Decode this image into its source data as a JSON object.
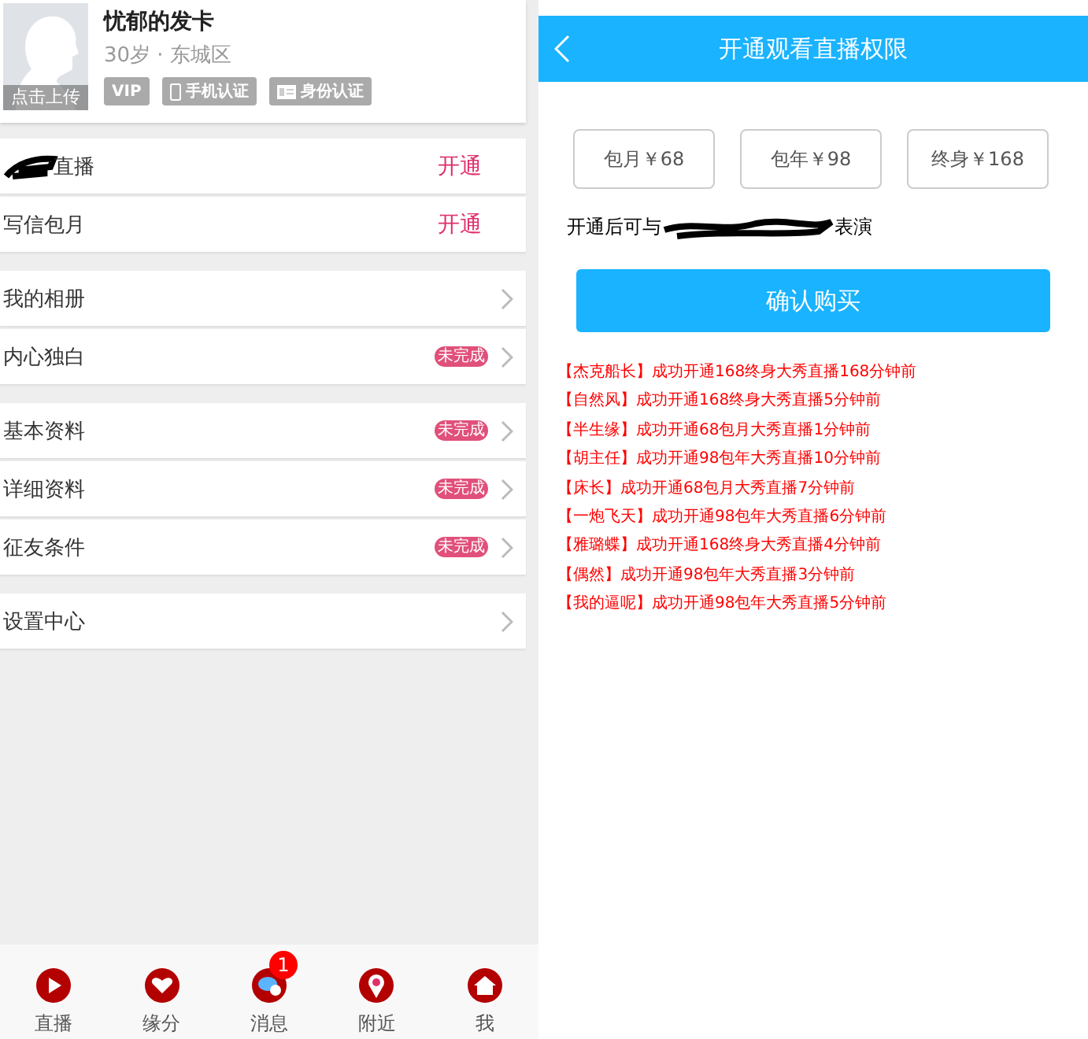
{
  "profile": {
    "name": "忧郁的发卡",
    "info": "30岁 · 东城区",
    "upload_label": "点击上传",
    "badges": [
      {
        "kind": "vip",
        "label": "VIP"
      },
      {
        "kind": "phone",
        "label": "手机认证"
      },
      {
        "kind": "id",
        "label": "身份认证"
      }
    ]
  },
  "menu_groups": [
    {
      "items": [
        {
          "label": "直播",
          "redacted": true,
          "action": "开通"
        },
        {
          "label": "写信包月",
          "redacted": false,
          "action": "开通"
        }
      ]
    },
    {
      "items": [
        {
          "label": "我的相册",
          "redacted": false
        },
        {
          "label": "内心独白",
          "redacted": false,
          "status": "未完成"
        }
      ]
    },
    {
      "items": [
        {
          "label": "基本资料",
          "redacted": false,
          "status": "未完成"
        },
        {
          "label": "详细资料",
          "redacted": false,
          "status": "未完成"
        },
        {
          "label": "征友条件",
          "redacted": false,
          "status": "未完成"
        }
      ]
    },
    {
      "items": [
        {
          "label": "设置中心",
          "redacted": false
        }
      ]
    }
  ],
  "tab_bar": [
    {
      "kind": "play",
      "label": "直播"
    },
    {
      "kind": "heart",
      "label": "缘分"
    },
    {
      "kind": "chat",
      "label": "消息",
      "badge": "1"
    },
    {
      "kind": "pin",
      "label": "附近"
    },
    {
      "kind": "home",
      "label": "我"
    }
  ],
  "purchase": {
    "title": "开通观看直播权限",
    "options": [
      {
        "label": "包月￥68",
        "selected": false
      },
      {
        "label": "包年￥98",
        "selected": false
      },
      {
        "label": "终身￥168",
        "selected": false
      }
    ],
    "note_start": "开通后可与",
    "note_end": "表演",
    "confirm": "确认购买",
    "records": [
      {
        "user": "【杰克船长】",
        "text": "成功开通168终身大秀直播168分钟前"
      },
      {
        "user": "【自然风】",
        "text": "成功开通168终身大秀直播5分钟前"
      },
      {
        "user": "【半生缘】",
        "text": "成功开通68包月大秀直播1分钟前"
      },
      {
        "user": "【胡主任】",
        "text": "成功开通98包年大秀直播10分钟前"
      },
      {
        "user": "【床长】",
        "text": "成功开通68包月大秀直播7分钟前"
      },
      {
        "user": "【一炮飞天】",
        "text": "成功开通98包年大秀直播6分钟前"
      },
      {
        "user": "【雅璐蝶】",
        "text": "成功开通168终身大秀直播4分钟前"
      },
      {
        "user": "【偶然】",
        "text": "成功开通98包年大秀直播3分钟前"
      },
      {
        "user": "【我的逼呢】",
        "text": "成功开通98包年大秀直播5分钟前"
      }
    ]
  }
}
